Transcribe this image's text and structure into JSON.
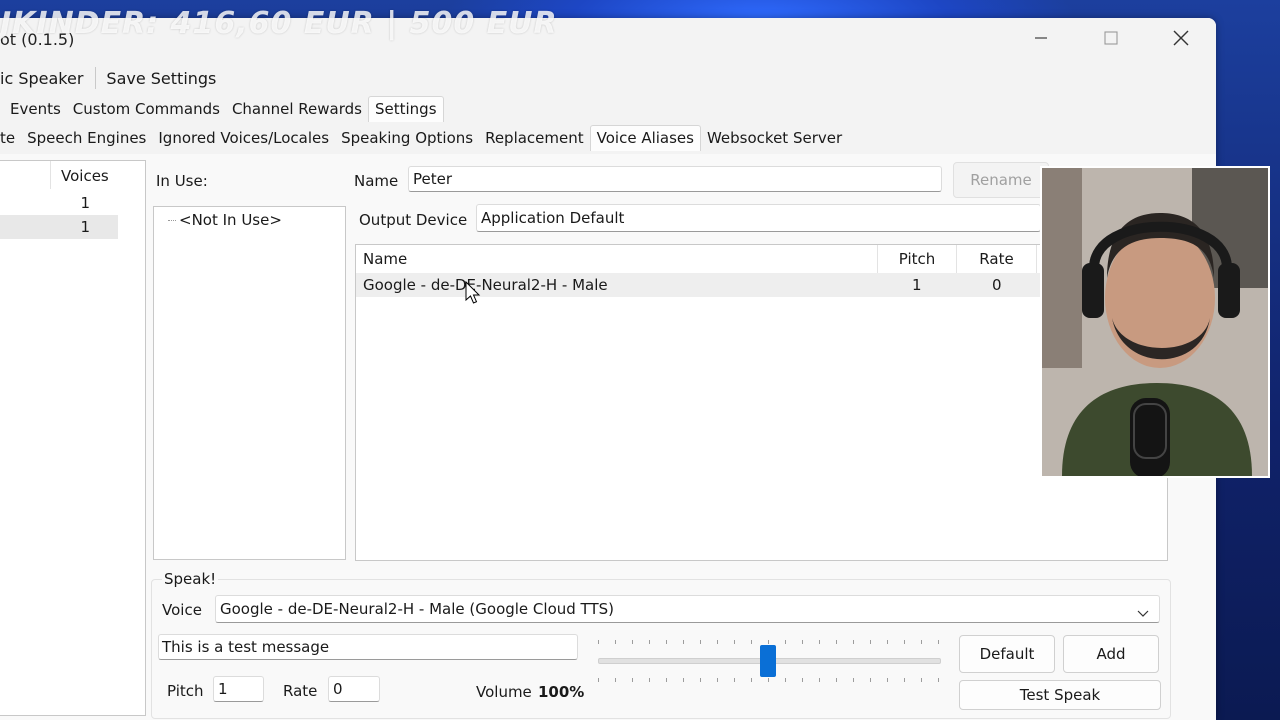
{
  "overlay": {
    "banner": "JKINDER: 416,60 EUR | 500 EUR"
  },
  "window": {
    "title": "ot (0.1.5)",
    "controls": {
      "minimize_icon": "minimize-icon",
      "maximize_icon": "maximize-icon",
      "close_icon": "close-icon"
    }
  },
  "menu": {
    "items": [
      "ic Speaker",
      "Save Settings"
    ]
  },
  "main_tabs": [
    "Events",
    "Custom Commands",
    "Channel Rewards",
    "Settings"
  ],
  "main_tabs_active": "Settings",
  "sub_tabs": [
    "te",
    "Speech Engines",
    "Ignored Voices/Locales",
    "Speaking Options",
    "Replacement",
    "Voice Aliases",
    "Websocket Server"
  ],
  "sub_tabs_active": "Voice Aliases",
  "left_list": {
    "header": "Voices",
    "rows": [
      {
        "value": "1"
      },
      {
        "value": "1"
      }
    ]
  },
  "in_use": {
    "label": "In Use:",
    "tree_item": "<Not In Use>"
  },
  "alias": {
    "name_label": "Name",
    "name_value": "Peter",
    "rename_button": "Rename",
    "output_label": "Output Device",
    "output_value": "Application Default"
  },
  "voice_table": {
    "columns": [
      "Name",
      "Pitch",
      "Rate"
    ],
    "rows": [
      {
        "name": "Google - de-DE-Neural2-H - Male",
        "pitch": "1",
        "rate": "0"
      }
    ]
  },
  "speak": {
    "group_label": "Speak!",
    "voice_label": "Voice",
    "voice_value": "Google - de-DE-Neural2-H - Male (Google Cloud TTS)",
    "message_value": "This is a test message",
    "pitch_label": "Pitch",
    "pitch_value": "1",
    "rate_label": "Rate",
    "rate_value": "0",
    "volume_label": "Volume",
    "volume_value": "100%",
    "slider_level": 0.5,
    "default_button": "Default",
    "add_button": "Add",
    "test_button": "Test Speak"
  },
  "colors": {
    "accent": "#0a6fd6",
    "window_bg": "#f3f3f3",
    "desktop": "#1c3f9e"
  }
}
